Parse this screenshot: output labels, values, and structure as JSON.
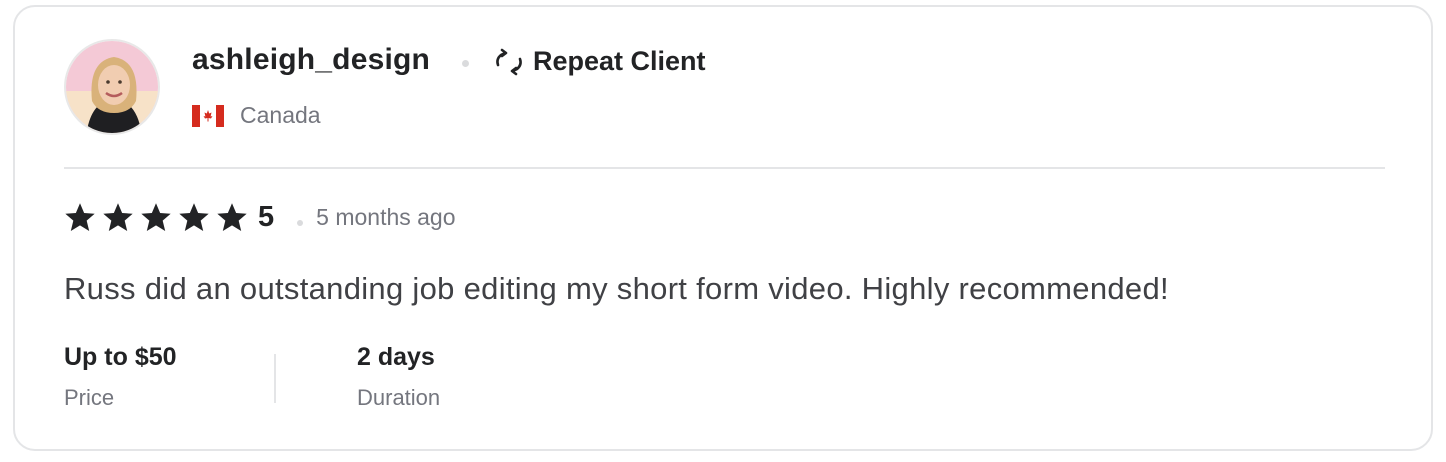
{
  "review": {
    "username": "ashleigh_design",
    "badge": {
      "label": "Repeat Client",
      "icon": "repeat-icon"
    },
    "country": {
      "name": "Canada",
      "flag_icon": "canada-flag-icon"
    },
    "rating": {
      "stars": 5,
      "max": 5,
      "value": "5"
    },
    "time_ago": "5 months ago",
    "text": "Russ did an outstanding job editing my short form video. Highly recommended!",
    "meta": {
      "price": {
        "value": "Up to $50",
        "label": "Price"
      },
      "duration": {
        "value": "2 days",
        "label": "Duration"
      }
    }
  },
  "colors": {
    "text_primary": "#222325",
    "text_secondary": "#74767e",
    "border": "#e4e5e7",
    "flag_red": "#d52b1e"
  }
}
